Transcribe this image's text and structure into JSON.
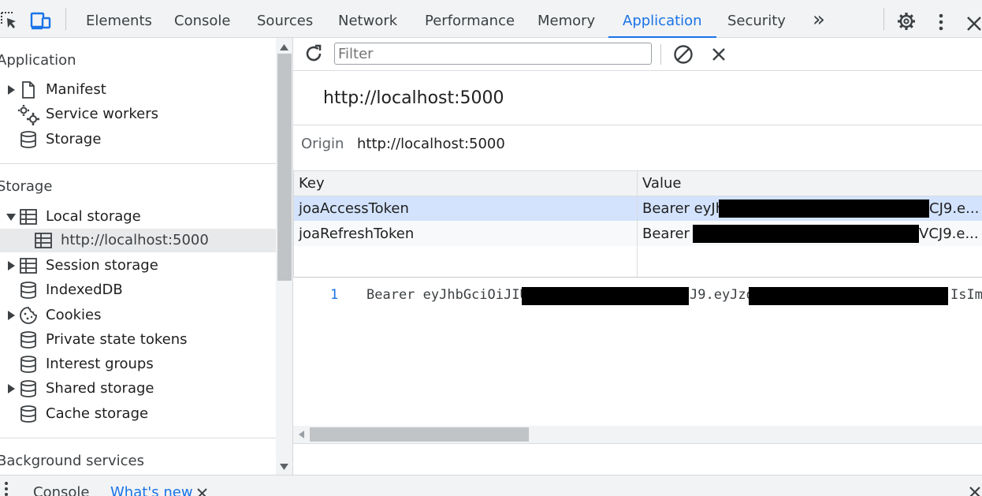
{
  "toolbar": {
    "tabs": [
      {
        "label": "Elements"
      },
      {
        "label": "Console"
      },
      {
        "label": "Sources"
      },
      {
        "label": "Network"
      },
      {
        "label": "Performance"
      },
      {
        "label": "Memory"
      },
      {
        "label": "Application"
      },
      {
        "label": "Security"
      }
    ],
    "more_label": "»",
    "active_tab": "Application",
    "accent_color": "#1a73e8"
  },
  "sidebar": {
    "application_title": "Application",
    "application_items": [
      {
        "label": "Manifest",
        "icon": "document-icon"
      },
      {
        "label": "Service workers",
        "icon": "gears-icon"
      },
      {
        "label": "Storage",
        "icon": "database-icon"
      }
    ],
    "storage_title": "Storage",
    "storage_items": [
      {
        "label": "Local storage",
        "icon": "table-icon"
      },
      {
        "label": "http://localhost:5000",
        "icon": "table-icon"
      },
      {
        "label": "Session storage",
        "icon": "table-icon"
      },
      {
        "label": "IndexedDB",
        "icon": "database-icon"
      },
      {
        "label": "Cookies",
        "icon": "cookie-icon"
      },
      {
        "label": "Private state tokens",
        "icon": "database-icon"
      },
      {
        "label": "Interest groups",
        "icon": "database-icon"
      },
      {
        "label": "Shared storage",
        "icon": "database-icon"
      },
      {
        "label": "Cache storage",
        "icon": "database-icon"
      }
    ],
    "background_title": "Background services"
  },
  "main": {
    "filter_placeholder": "Filter",
    "origin_heading": "http://localhost:5000",
    "origin_label": "Origin",
    "origin_value": "http://localhost:5000",
    "table": {
      "headers": {
        "key": "Key",
        "value": "Value"
      },
      "rows": [
        {
          "key": "joaAccessToken",
          "value_start": "Bearer eyJh",
          "value_end": "CJ9.e..."
        },
        {
          "key": "joaRefreshToken",
          "value_start": "Bearer e",
          "value_end": "VCJ9.e..."
        }
      ]
    },
    "preview": {
      "line_number": "1",
      "seg1": "Bearer eyJhbGciOiJIU",
      "seg2": "J9.eyJzd",
      "seg3": "IsIm"
    }
  },
  "drawer": {
    "tabs": [
      {
        "label": "Console"
      },
      {
        "label": "What's new"
      }
    ]
  }
}
